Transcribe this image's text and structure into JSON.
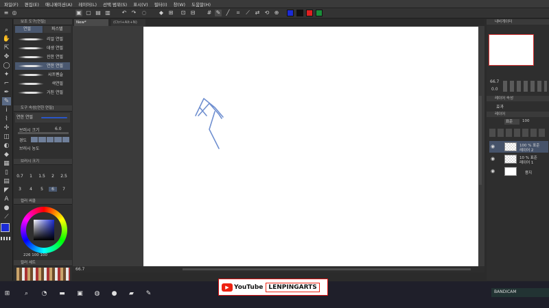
{
  "menubar": {
    "items": [
      "파일(F)",
      "편집(E)",
      "애니메이션(A)",
      "레이어(L)",
      "선택 범위(S)",
      "표시(V)",
      "필터(I)",
      "창(W)",
      "도움말(H)"
    ]
  },
  "toolbar": {
    "swatch_colors": [
      "#1b2bd6",
      "#111111",
      "#e02020",
      "#1a8f3a"
    ]
  },
  "subtool_panel": {
    "header": "보조 도구[연필]",
    "tabs": [
      "연필",
      "파스텔"
    ],
    "brushes": [
      "리얼 연필",
      "데생 연필",
      "진한 연필",
      "연한 연필",
      "샤프펜슬",
      "색연필",
      "거친 연필"
    ],
    "selected_brush_index": 3
  },
  "tool_property": {
    "header": "도구 속성[연한 연필]",
    "brush_name": "연한 연필",
    "size_label": "브러시 크기",
    "size_value": "6.0",
    "hardness_label": "경도",
    "density_label": "브러시 농도"
  },
  "brush_size_panel": {
    "header": "브러시 크기",
    "row1": [
      "0.7",
      "1",
      "1.5",
      "2",
      "2.5"
    ],
    "row2": [
      "3",
      "4",
      "5",
      "6",
      "7"
    ]
  },
  "color_panel": {
    "header": "컬러 써클",
    "readout": "226  100  100",
    "main_color": "#1b2bd6"
  },
  "color_set_panel": {
    "header": "컬러 세트"
  },
  "canvas": {
    "tabs": [
      "New*",
      "(Ctrl+Alt+N)"
    ],
    "zoom": "66.7",
    "stroke_color": "#6f8fd0"
  },
  "navigator": {
    "header": "내비게이터",
    "zoom": "66.7",
    "angle": "0.0"
  },
  "layer_property": {
    "header": "레이어 속성",
    "effect_label": "효과"
  },
  "layers_panel": {
    "header": "레이어",
    "blend_mode": "표준",
    "opacity": "100",
    "layers": [
      {
        "top": "100 % 표준",
        "name": "레이어 2",
        "selected": true
      },
      {
        "top": "10 % 표준",
        "name": "레이어 1",
        "selected": false
      },
      {
        "top": "",
        "name": "용지",
        "selected": false
      }
    ]
  },
  "overlay": {
    "youtube_label": "YouTube",
    "channel": "LENPINGARTS",
    "recorder": "BANDICAM"
  }
}
